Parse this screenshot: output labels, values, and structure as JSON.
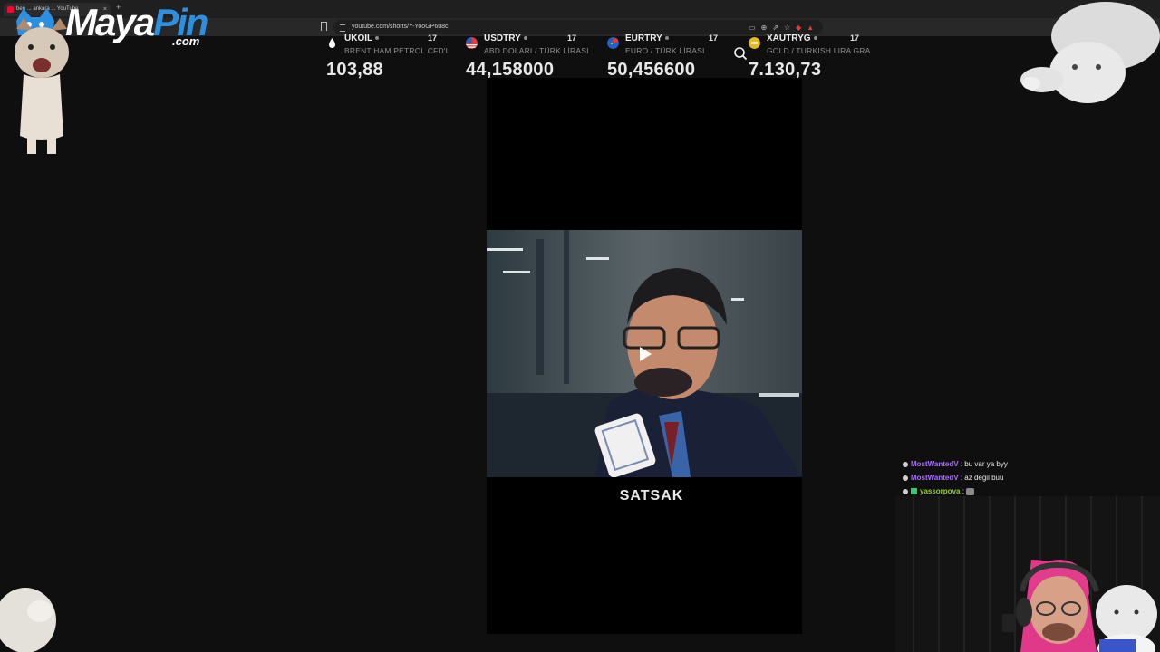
{
  "browser": {
    "tab_title": "ben ... ankara ... YouTube",
    "new_tab_glyph": "+",
    "close_glyph": "×",
    "url": "youtube.com/shorts/Y-YooGP6u8c"
  },
  "logo": {
    "text_main": "Maya",
    "text_accent": "Pin",
    "text_suffix": ".com"
  },
  "ticker": {
    "tv_mark": "17",
    "items": [
      {
        "symbol": "UKOIL",
        "description": "BRENT HAM PETROL CFD'L",
        "price": "103,88",
        "icon": "oil-drop-icon",
        "color": "#ffffff"
      },
      {
        "symbol": "USDTRY",
        "description": "ABD DOLARI / TÜRK LİRASI",
        "price": "44,158000",
        "icon": "us-tr-flags-icon",
        "color": "#e53935"
      },
      {
        "symbol": "EURTRY",
        "description": "EURO / TÜRK LİRASI",
        "price": "50,456600",
        "icon": "eu-tr-flags-icon",
        "color": "#1e63c6"
      },
      {
        "symbol": "XAUTRYG",
        "description": "GOLD / TURKISH LIRA GRA",
        "price": "7.130,73",
        "icon": "gold-icon",
        "color": "#e8b820"
      }
    ]
  },
  "video": {
    "caption": "SATSAK",
    "play_icon": "play-icon"
  },
  "chat": {
    "messages": [
      {
        "user": "MostWantedV",
        "separator": " : ",
        "text": "bu var ya byy",
        "color": "#a970ff"
      },
      {
        "user": "MostWantedV",
        "separator": " : ",
        "text": "az değil buu",
        "color": "#a970ff"
      },
      {
        "user": "yassorpova",
        "separator": " : ",
        "text": "",
        "color": "#9acd32"
      }
    ]
  }
}
